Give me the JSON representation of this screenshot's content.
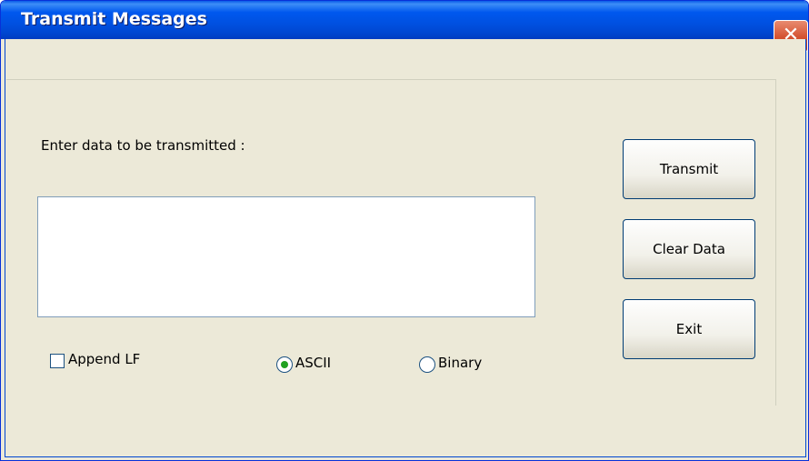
{
  "window": {
    "title": "Transmit Messages",
    "close_label": "✕"
  },
  "form": {
    "prompt": "Enter data to be transmitted :",
    "data_value": "",
    "append_lf": {
      "label": "Append LF",
      "checked": false
    },
    "mode": {
      "options": [
        {
          "label": "ASCII",
          "selected": true
        },
        {
          "label": "Binary",
          "selected": false
        }
      ]
    }
  },
  "buttons": {
    "transmit": "Transmit",
    "clear_data": "Clear Data",
    "exit": "Exit"
  },
  "colors": {
    "titlebar": "#0058ee",
    "close_button": "#d4502f",
    "dialog_bg": "#ece9d8",
    "radio_dot": "#21a121"
  }
}
